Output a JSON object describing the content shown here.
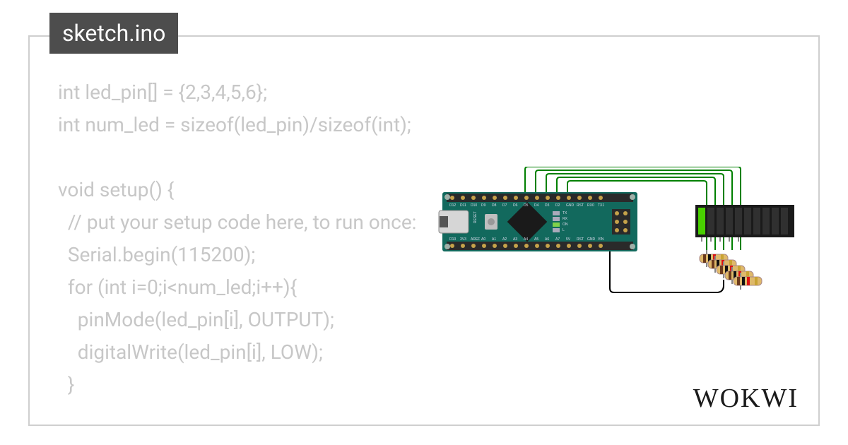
{
  "tab_title": "sketch.ino",
  "brand": "WOKWI",
  "code_lines": [
    "int led_pin[] = {2,3,4,5,6};",
    "int num_led = sizeof(led_pin)/sizeof(int);",
    "",
    "void setup() {",
    "  // put your setup code here, to run once:",
    "  Serial.begin(115200);",
    "  for (int i=0;i<num_led;i++){",
    "    pinMode(led_pin[i], OUTPUT);",
    "    digitalWrite(led_pin[i], LOW);",
    "  }"
  ],
  "board": {
    "top_pins": [
      "D12",
      "D11",
      "D10",
      "D9",
      "D8",
      "D7",
      "D6",
      "D5",
      "D4",
      "D3",
      "D2",
      "GND",
      "RST",
      "RX0",
      "TX1"
    ],
    "bottom_pins": [
      "D13",
      "3V3",
      "AREF",
      "A0",
      "A1",
      "A2",
      "A3",
      "A4",
      "A5",
      "A6",
      "A7",
      "5V",
      "RST",
      "GND",
      "VIN"
    ],
    "side_labels": [
      "TX",
      "RX",
      "ON",
      "L"
    ],
    "reset_label": "RESET"
  }
}
